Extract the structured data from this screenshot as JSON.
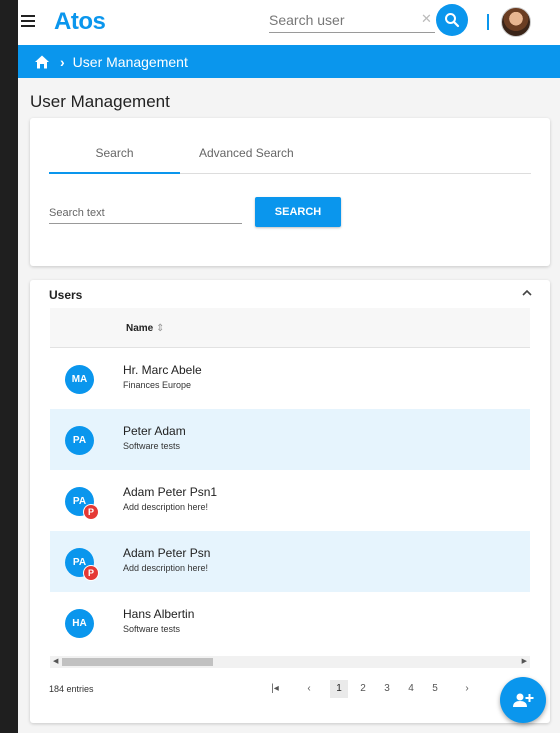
{
  "header": {
    "logo_text": "Atos",
    "search_placeholder": "Search user",
    "clear_glyph": "✕",
    "accent_color": "#0a96ed"
  },
  "breadcrumb": {
    "home_icon": "home-icon",
    "separator": "›",
    "current": "User Management"
  },
  "page": {
    "title": "User Management"
  },
  "search_card": {
    "tabs": [
      {
        "label": "Search",
        "active": true
      },
      {
        "label": "Advanced Search",
        "active": false
      }
    ],
    "input_placeholder": "Search text",
    "button_label": "SEARCH"
  },
  "users_card": {
    "title": "Users",
    "collapse_icon": "chevron-up-icon",
    "column_name": "Name",
    "sort_glyph": "⇕",
    "rows": [
      {
        "initials": "MA",
        "name": "Hr. Marc Abele",
        "description": "Finances Europe",
        "badge": ""
      },
      {
        "initials": "PA",
        "name": "Peter Adam",
        "description": "Software tests",
        "badge": ""
      },
      {
        "initials": "PA",
        "name": "Adam Peter Psn1",
        "description": "Add description here!",
        "badge": "P"
      },
      {
        "initials": "PA",
        "name": "Adam Peter Psn",
        "description": "Add description here!",
        "badge": "P"
      },
      {
        "initials": "HA",
        "name": "Hans Albertin",
        "description": "Software tests",
        "badge": ""
      }
    ],
    "entries": "184 entries",
    "pagination": {
      "first": "|◂",
      "prev": "‹",
      "pages": [
        "1",
        "2",
        "3",
        "4",
        "5"
      ],
      "current": "1",
      "next": "›"
    }
  },
  "fab": {
    "icon": "add-user-icon"
  }
}
